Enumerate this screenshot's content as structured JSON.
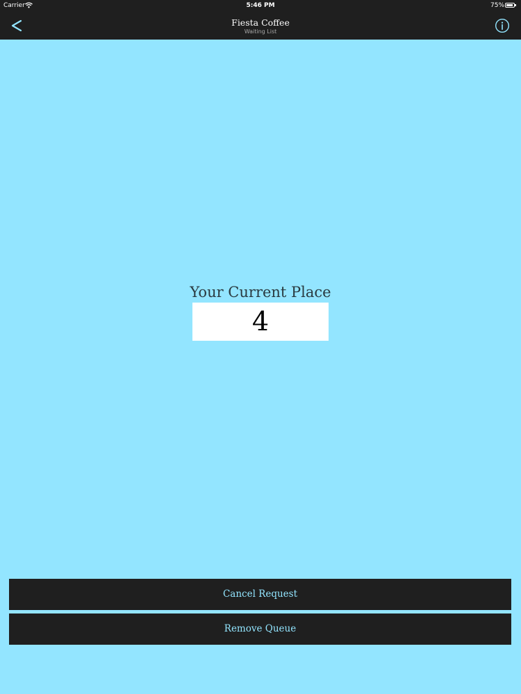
{
  "status_bar": {
    "carrier": "Carrier",
    "time": "5:46 PM",
    "battery": "75%",
    "wifi_icon": "wifi-icon",
    "battery_icon": "battery-icon"
  },
  "nav": {
    "title": "Fiesta Coffee",
    "subtitle": "Waiting List",
    "back_icon": "chevron-left-icon",
    "info_icon": "info-icon"
  },
  "queue": {
    "label": "Your Current Place",
    "place": "4"
  },
  "actions": {
    "cancel_label": "Cancel Request",
    "remove_label": "Remove Queue"
  },
  "colors": {
    "background": "#93e5ff",
    "bar": "#1f1f1f",
    "accent": "#93e5ff"
  }
}
